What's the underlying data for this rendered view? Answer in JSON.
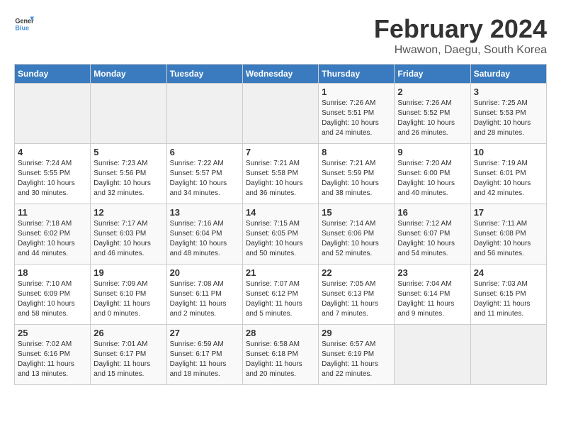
{
  "logo": {
    "line1": "General",
    "line2": "Blue"
  },
  "title": "February 2024",
  "subtitle": "Hwawon, Daegu, South Korea",
  "days_of_week": [
    "Sunday",
    "Monday",
    "Tuesday",
    "Wednesday",
    "Thursday",
    "Friday",
    "Saturday"
  ],
  "weeks": [
    [
      {
        "day": "",
        "info": ""
      },
      {
        "day": "",
        "info": ""
      },
      {
        "day": "",
        "info": ""
      },
      {
        "day": "",
        "info": ""
      },
      {
        "day": "1",
        "info": "Sunrise: 7:26 AM\nSunset: 5:51 PM\nDaylight: 10 hours\nand 24 minutes."
      },
      {
        "day": "2",
        "info": "Sunrise: 7:26 AM\nSunset: 5:52 PM\nDaylight: 10 hours\nand 26 minutes."
      },
      {
        "day": "3",
        "info": "Sunrise: 7:25 AM\nSunset: 5:53 PM\nDaylight: 10 hours\nand 28 minutes."
      }
    ],
    [
      {
        "day": "4",
        "info": "Sunrise: 7:24 AM\nSunset: 5:55 PM\nDaylight: 10 hours\nand 30 minutes."
      },
      {
        "day": "5",
        "info": "Sunrise: 7:23 AM\nSunset: 5:56 PM\nDaylight: 10 hours\nand 32 minutes."
      },
      {
        "day": "6",
        "info": "Sunrise: 7:22 AM\nSunset: 5:57 PM\nDaylight: 10 hours\nand 34 minutes."
      },
      {
        "day": "7",
        "info": "Sunrise: 7:21 AM\nSunset: 5:58 PM\nDaylight: 10 hours\nand 36 minutes."
      },
      {
        "day": "8",
        "info": "Sunrise: 7:21 AM\nSunset: 5:59 PM\nDaylight: 10 hours\nand 38 minutes."
      },
      {
        "day": "9",
        "info": "Sunrise: 7:20 AM\nSunset: 6:00 PM\nDaylight: 10 hours\nand 40 minutes."
      },
      {
        "day": "10",
        "info": "Sunrise: 7:19 AM\nSunset: 6:01 PM\nDaylight: 10 hours\nand 42 minutes."
      }
    ],
    [
      {
        "day": "11",
        "info": "Sunrise: 7:18 AM\nSunset: 6:02 PM\nDaylight: 10 hours\nand 44 minutes."
      },
      {
        "day": "12",
        "info": "Sunrise: 7:17 AM\nSunset: 6:03 PM\nDaylight: 10 hours\nand 46 minutes."
      },
      {
        "day": "13",
        "info": "Sunrise: 7:16 AM\nSunset: 6:04 PM\nDaylight: 10 hours\nand 48 minutes."
      },
      {
        "day": "14",
        "info": "Sunrise: 7:15 AM\nSunset: 6:05 PM\nDaylight: 10 hours\nand 50 minutes."
      },
      {
        "day": "15",
        "info": "Sunrise: 7:14 AM\nSunset: 6:06 PM\nDaylight: 10 hours\nand 52 minutes."
      },
      {
        "day": "16",
        "info": "Sunrise: 7:12 AM\nSunset: 6:07 PM\nDaylight: 10 hours\nand 54 minutes."
      },
      {
        "day": "17",
        "info": "Sunrise: 7:11 AM\nSunset: 6:08 PM\nDaylight: 10 hours\nand 56 minutes."
      }
    ],
    [
      {
        "day": "18",
        "info": "Sunrise: 7:10 AM\nSunset: 6:09 PM\nDaylight: 10 hours\nand 58 minutes."
      },
      {
        "day": "19",
        "info": "Sunrise: 7:09 AM\nSunset: 6:10 PM\nDaylight: 11 hours\nand 0 minutes."
      },
      {
        "day": "20",
        "info": "Sunrise: 7:08 AM\nSunset: 6:11 PM\nDaylight: 11 hours\nand 2 minutes."
      },
      {
        "day": "21",
        "info": "Sunrise: 7:07 AM\nSunset: 6:12 PM\nDaylight: 11 hours\nand 5 minutes."
      },
      {
        "day": "22",
        "info": "Sunrise: 7:05 AM\nSunset: 6:13 PM\nDaylight: 11 hours\nand 7 minutes."
      },
      {
        "day": "23",
        "info": "Sunrise: 7:04 AM\nSunset: 6:14 PM\nDaylight: 11 hours\nand 9 minutes."
      },
      {
        "day": "24",
        "info": "Sunrise: 7:03 AM\nSunset: 6:15 PM\nDaylight: 11 hours\nand 11 minutes."
      }
    ],
    [
      {
        "day": "25",
        "info": "Sunrise: 7:02 AM\nSunset: 6:16 PM\nDaylight: 11 hours\nand 13 minutes."
      },
      {
        "day": "26",
        "info": "Sunrise: 7:01 AM\nSunset: 6:17 PM\nDaylight: 11 hours\nand 15 minutes."
      },
      {
        "day": "27",
        "info": "Sunrise: 6:59 AM\nSunset: 6:17 PM\nDaylight: 11 hours\nand 18 minutes."
      },
      {
        "day": "28",
        "info": "Sunrise: 6:58 AM\nSunset: 6:18 PM\nDaylight: 11 hours\nand 20 minutes."
      },
      {
        "day": "29",
        "info": "Sunrise: 6:57 AM\nSunset: 6:19 PM\nDaylight: 11 hours\nand 22 minutes."
      },
      {
        "day": "",
        "info": ""
      },
      {
        "day": "",
        "info": ""
      }
    ]
  ]
}
